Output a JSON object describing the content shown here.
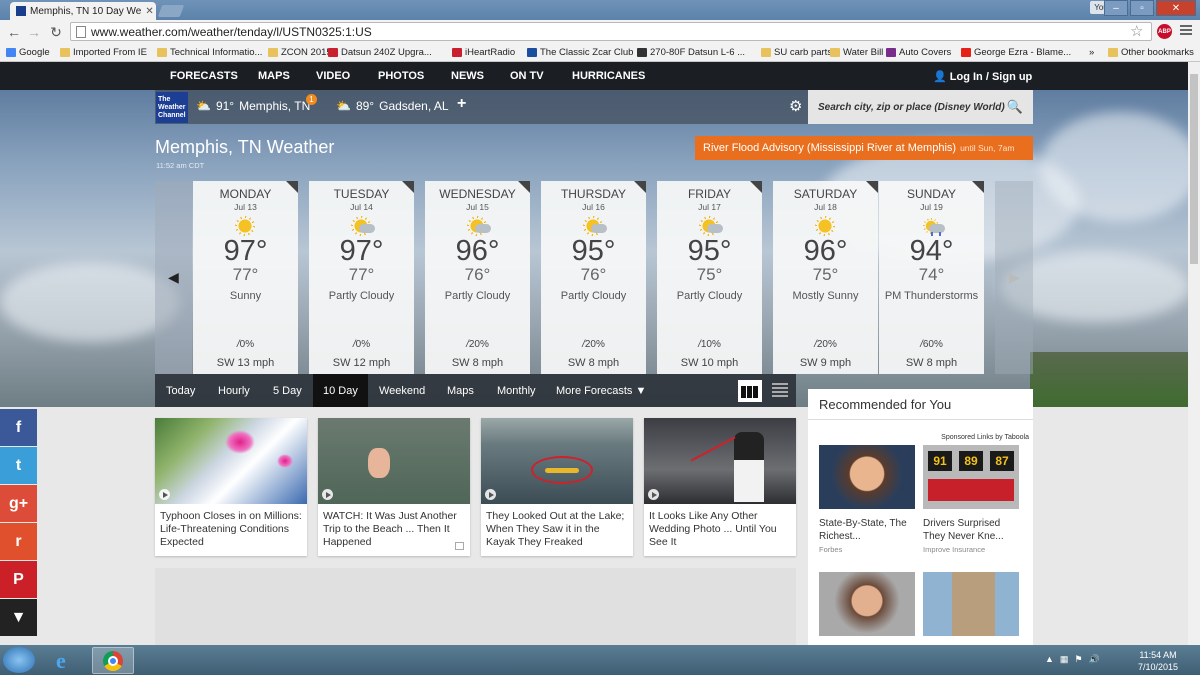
{
  "browser": {
    "tab_title": "Memphis, TN 10 Day We",
    "user_badge": "You",
    "url": "www.weather.com/weather/tenday/l/USTN0325:1:US",
    "bookmarks": [
      {
        "label": "Google",
        "color": "#4285f4"
      },
      {
        "label": "Imported From IE",
        "color": "#e8c25c"
      },
      {
        "label": "Technical Informatio...",
        "color": "#e8c25c"
      },
      {
        "label": "ZCON 2015",
        "color": "#e8c25c"
      },
      {
        "label": "Datsun 240Z Upgra...",
        "color": "#c8202f"
      },
      {
        "label": "iHeartRadio",
        "color": "#c8202f"
      },
      {
        "label": "The Classic Zcar Club",
        "color": "#1a4fa0"
      },
      {
        "label": "270-80F Datsun L-6 ...",
        "color": "#333333"
      },
      {
        "label": "SU carb parts",
        "color": "#e8c25c"
      },
      {
        "label": "Water Bill",
        "color": "#e8c25c"
      },
      {
        "label": "Auto Covers",
        "color": "#7a2c8c"
      },
      {
        "label": "George Ezra - Blame...",
        "color": "#e62117"
      }
    ],
    "bookmarks_more": "»",
    "other_bookmarks": "Other bookmarks"
  },
  "site": {
    "nav": [
      "FORECASTS",
      "MAPS",
      "VIDEO",
      "PHOTOS",
      "NEWS",
      "ON TV",
      "HURRICANES"
    ],
    "login": "Log In",
    "login_sep": "/",
    "signup": "Sign up",
    "logo": [
      "The",
      "Weather",
      "Channel"
    ],
    "locations": [
      {
        "temp": "91°",
        "name": "Memphis, TN",
        "badge": "1"
      },
      {
        "temp": "89°",
        "name": "Gadsden, AL"
      }
    ],
    "search_placeholder": "Search city, zip or place (Disney World)",
    "city_title": "Memphis, TN Weather",
    "city_time": "11:52 am CDT",
    "advisory": "River Flood Advisory (Mississippi River at Memphis)",
    "advisory_until": "until Sun, 7am"
  },
  "forecast": [
    {
      "day": "MONDAY",
      "date": "Jul 13",
      "hi": "97°",
      "lo": "77°",
      "cond": "Sunny",
      "precip": "0%",
      "wind": "SW 13 mph",
      "icon": "sun"
    },
    {
      "day": "TUESDAY",
      "date": "Jul 14",
      "hi": "97°",
      "lo": "77°",
      "cond": "Partly Cloudy",
      "precip": "0%",
      "wind": "SW 12 mph",
      "icon": "partly-cloudy"
    },
    {
      "day": "WEDNESDAY",
      "date": "Jul 15",
      "hi": "96°",
      "lo": "76°",
      "cond": "Partly Cloudy",
      "precip": "20%",
      "wind": "SW 8 mph",
      "icon": "partly-cloudy"
    },
    {
      "day": "THURSDAY",
      "date": "Jul 16",
      "hi": "95°",
      "lo": "76°",
      "cond": "Partly Cloudy",
      "precip": "20%",
      "wind": "SW 8 mph",
      "icon": "partly-cloudy"
    },
    {
      "day": "FRIDAY",
      "date": "Jul 17",
      "hi": "95°",
      "lo": "75°",
      "cond": "Partly Cloudy",
      "precip": "10%",
      "wind": "SW 10 mph",
      "icon": "partly-cloudy"
    },
    {
      "day": "SATURDAY",
      "date": "Jul 18",
      "hi": "96°",
      "lo": "75°",
      "cond": "Mostly Sunny",
      "precip": "20%",
      "wind": "SW 9 mph",
      "icon": "sun"
    },
    {
      "day": "SUNDAY",
      "date": "Jul 19",
      "hi": "94°",
      "lo": "74°",
      "cond": "PM Thunderstorms",
      "precip": "60%",
      "wind": "SW 8 mph",
      "icon": "thunderstorm"
    }
  ],
  "subnav": [
    "Today",
    "Hourly",
    "5 Day",
    "10 Day",
    "Weekend",
    "Maps",
    "Monthly",
    "More Forecasts ▼"
  ],
  "subnav_active": "10 Day",
  "social": [
    {
      "label": "f",
      "color": "#3b5998"
    },
    {
      "label": "t",
      "color": "#3a9fd9"
    },
    {
      "label": "g+",
      "color": "#dd4b39"
    },
    {
      "label": "r",
      "color": "#e0502d"
    },
    {
      "label": "P",
      "color": "#cb2027"
    },
    {
      "label": "▼",
      "color": "#222222"
    }
  ],
  "news": [
    {
      "text": "Typhoon Closes in on Millions: Life-Threatening Conditions Expected"
    },
    {
      "text": "WATCH: It Was Just Another Trip to the Beach ... Then It Happened"
    },
    {
      "text": "They Looked Out at the Lake; When They Saw it in the Kayak They Freaked"
    },
    {
      "text": "It Looks Like Any Other Wedding Photo ... Until You See It"
    }
  ],
  "recommended": {
    "title": "Recommended for You",
    "sponsored": "Sponsored Links by Taboola",
    "items": [
      {
        "title": "State-By-State, The Richest...",
        "source": "Forbes"
      },
      {
        "title": "Drivers Surprised They Never Kne...",
        "source": "Improve Insurance"
      }
    ],
    "gas_prices": [
      "91",
      "89",
      "87"
    ]
  },
  "taskbar": {
    "time": "11:54 AM",
    "date": "7/10/2015"
  }
}
